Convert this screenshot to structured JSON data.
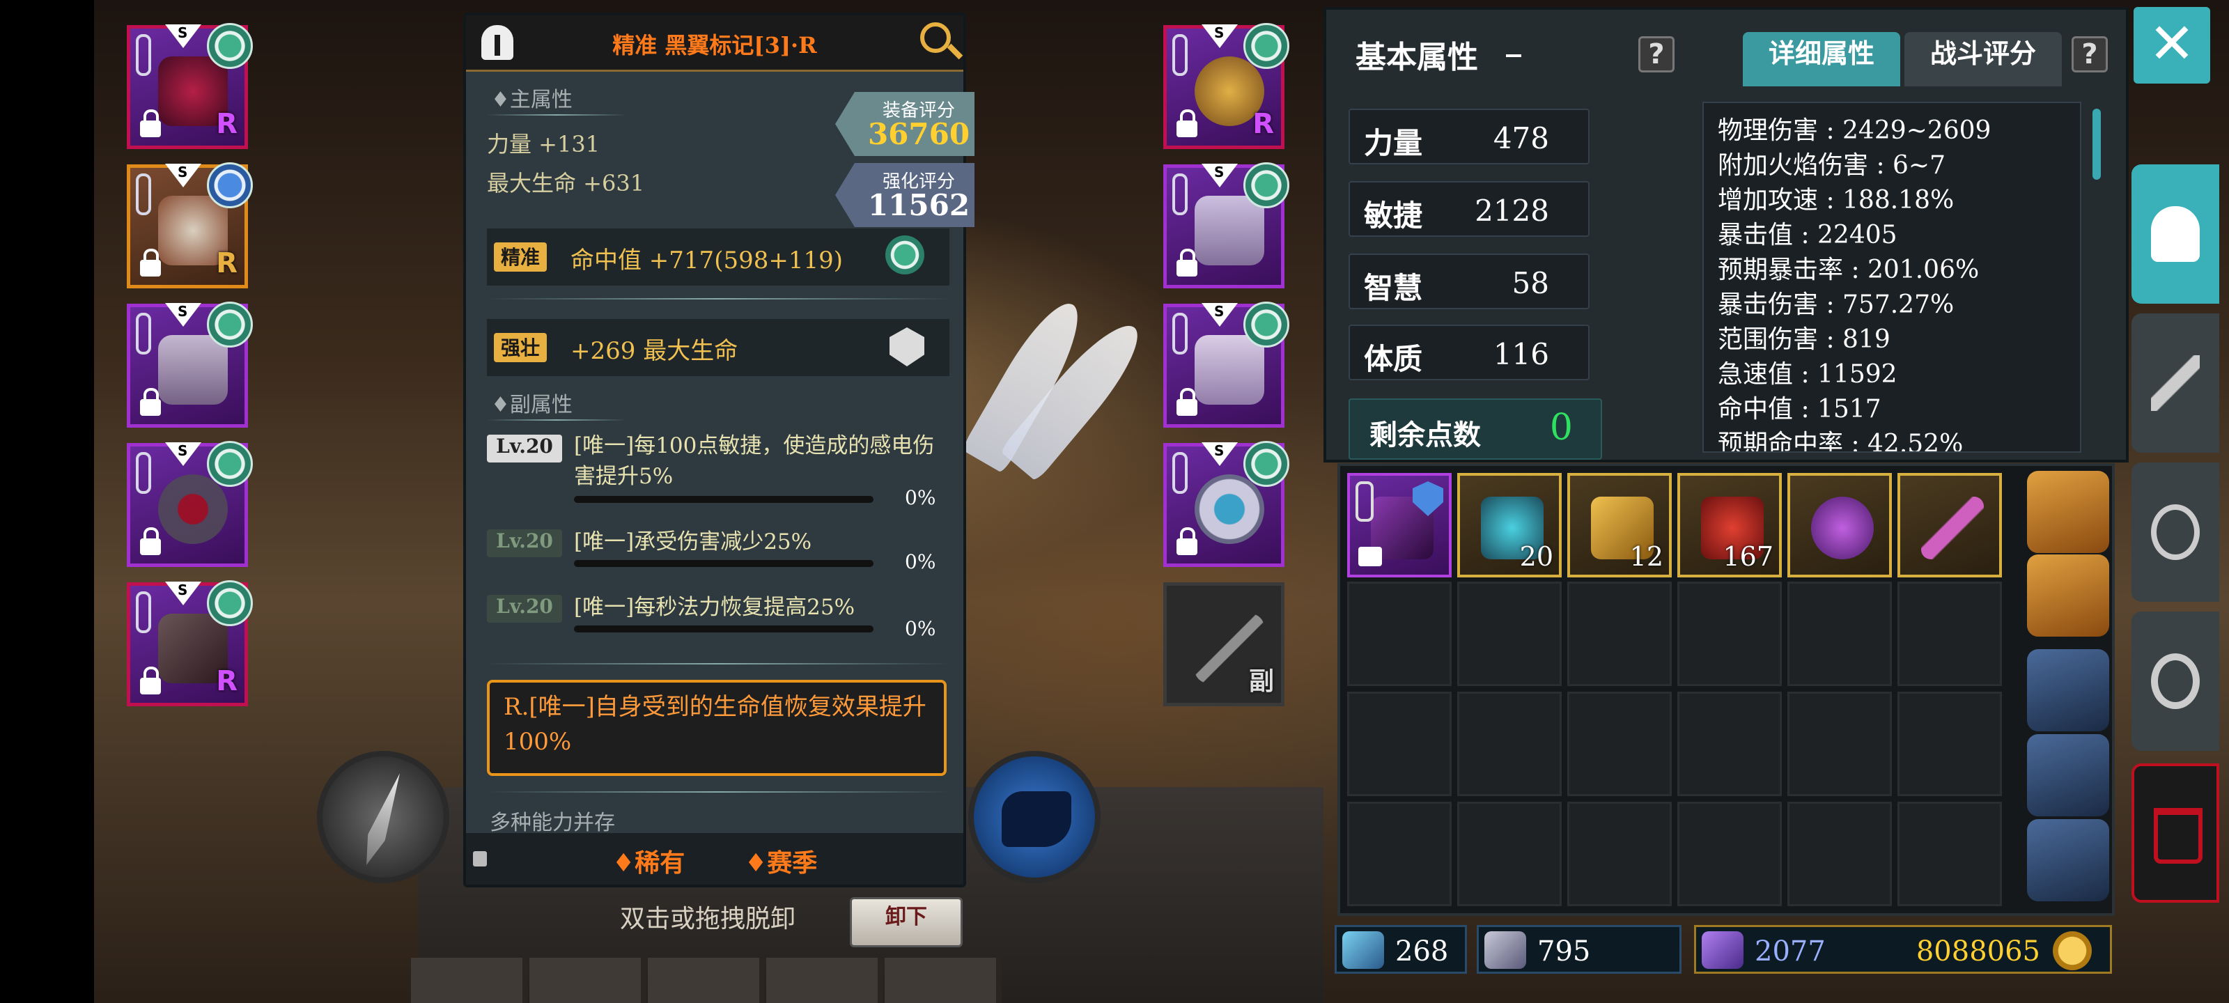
{
  "item": {
    "title": "精准 黑翼标记[3]·R",
    "main_attr_label": "♦主属性",
    "main_stats": [
      "力量 +131",
      "最大生命 +631"
    ],
    "score_label": "装备评分",
    "score_value": "36760",
    "enhance_label": "强化评分",
    "enhance_value": "11562",
    "prefix_tag": "精准",
    "prefix_text": "命中值 +717(598+119)",
    "suffix_tag": "强壮",
    "suffix_text": "+269 最大生命",
    "sub_attr_label": "♦副属性",
    "sub_attrs": [
      {
        "level": "Lv.20",
        "text": "[唯一]每100点敏捷，使造成的感电伤害提升5%",
        "pct": "0%"
      },
      {
        "level": "Lv.20",
        "text": "[唯一]承受伤害减少25%",
        "pct": "0%"
      },
      {
        "level": "Lv.20",
        "text": "[唯一]每秒法力恢复提高25%",
        "pct": "0%"
      }
    ],
    "unique_text": "R.[唯一]自身受到的生命值恢复效果提升100%",
    "multi_label": "多种能力并存",
    "rarity": "♦稀有",
    "season": "♦赛季"
  },
  "hint": "双击或拖拽脱卸",
  "unequip_label": "卸下",
  "slot_labels": {
    "s_rank": "S",
    "r_badge": "R",
    "offhand": "副"
  },
  "attrs": {
    "title": "基本属性",
    "tab_detail": "详细属性",
    "tab_battle": "战斗评分",
    "help": "?",
    "base": [
      {
        "name": "力量",
        "value": "478"
      },
      {
        "name": "敏捷",
        "value": "2128"
      },
      {
        "name": "智慧",
        "value": "58"
      },
      {
        "name": "体质",
        "value": "116"
      }
    ],
    "remain_label": "剩余点数",
    "remain_value": "0",
    "details": [
      "物理伤害 : 2429~2609",
      "附加火焰伤害 : 6~7",
      "增加攻速 : 188.18%",
      "暴击值 : 22405",
      "预期暴击率 : 201.06%",
      "暴击伤害 : 757.27%",
      "范围伤害 : 819",
      "急速值 : 11592",
      "命中值 : 1517",
      "预期命中率 : 42.52%"
    ]
  },
  "inventory": {
    "counts": [
      "20",
      "12",
      "167"
    ]
  },
  "currency": {
    "c1": "268",
    "c2": "795",
    "c3": "2077",
    "gold": "8088065"
  },
  "sidebar": {
    "close": "✕"
  }
}
